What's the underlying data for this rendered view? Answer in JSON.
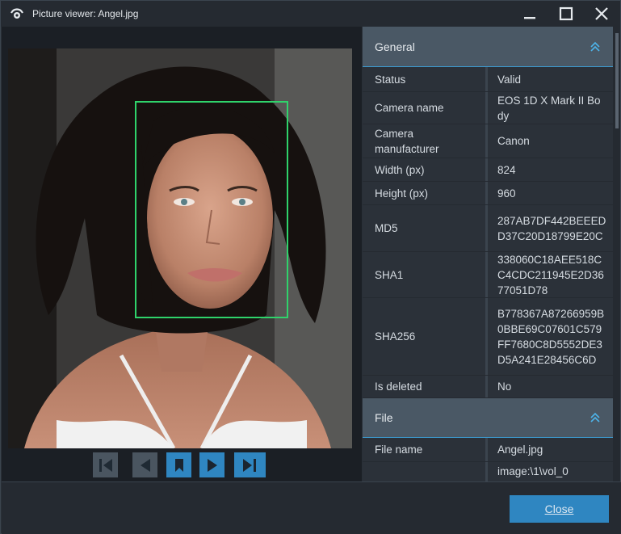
{
  "window": {
    "title": "Picture viewer: Angel.jpg"
  },
  "sections": [
    {
      "title": "General",
      "rows": [
        {
          "key": "Status",
          "value": "Valid"
        },
        {
          "key": "Camera name",
          "value": "EOS 1D X Mark II Body"
        },
        {
          "key": "Camera manufacturer",
          "value": "Canon"
        },
        {
          "key": "Width (px)",
          "value": "824"
        },
        {
          "key": "Height (px)",
          "value": "960"
        },
        {
          "key": "MD5",
          "value": "287AB7DF442BEEEDD37C20D18799E20C"
        },
        {
          "key": "SHA1",
          "value": "338060C18AEE518CC4CDC211945E2D3677051D78"
        },
        {
          "key": "SHA256",
          "value": "B778367A87266959B0BBE69C07601C579FF7680C8D5552DE3D5A241E28456C6D"
        },
        {
          "key": "Is deleted",
          "value": "No"
        }
      ]
    },
    {
      "title": "File",
      "rows": [
        {
          "key": "File name",
          "value": "Angel.jpg"
        },
        {
          "key": "",
          "value": "image:\\1\\vol_0"
        }
      ]
    }
  ],
  "footer": {
    "close_label": "Close"
  },
  "icons": {
    "app": "eye-icon",
    "minimize": "minimize-icon",
    "maximize": "maximize-icon",
    "close": "close-icon",
    "first": "skip-first-icon",
    "prev": "previous-icon",
    "bookmark": "bookmark-icon",
    "next": "next-icon",
    "last": "skip-last-icon",
    "collapse": "chevron-double-up-icon"
  },
  "colors": {
    "accent": "#2f86c1",
    "face_box": "#2fd36b",
    "header": "#4a5865"
  }
}
